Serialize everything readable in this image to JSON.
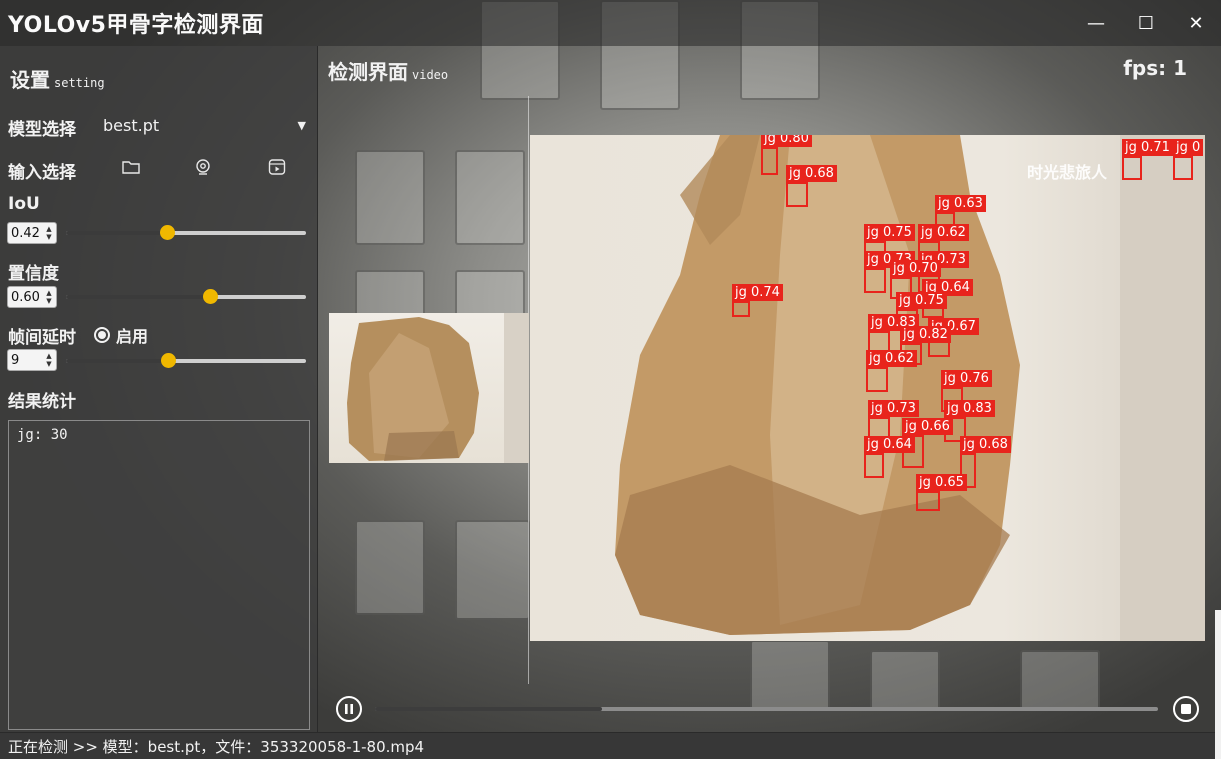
{
  "window": {
    "title": "YOLOv5甲骨字检测界面",
    "controls": {
      "minimize": "—",
      "maximize": "☐",
      "close": "✕"
    }
  },
  "settings": {
    "title": "设置",
    "subtitle": "setting",
    "model_label": "模型选择",
    "model_value": "best.pt",
    "input_label": "输入选择",
    "iou_label": "IoU",
    "iou_value": "0.42",
    "iou_level": 0.42,
    "conf_label": "置信度",
    "conf_value": "0.60",
    "conf_level": 0.6,
    "delay_label": "帧间延时",
    "delay_enable_label": "启用",
    "delay_value": "9",
    "results_title": "结果统计",
    "results_text": "jg: 30"
  },
  "main": {
    "title": "检测界面",
    "subtitle": "video",
    "fps_text": "fps: 1",
    "watermark": "时光悲旅人",
    "progress": 0.29
  },
  "detections": [
    {
      "label": "jg 0.80"
    },
    {
      "label": "jg 0.68"
    },
    {
      "label": "jg 0.63"
    },
    {
      "label": "jg 0.75"
    },
    {
      "label": "jg 0.62"
    },
    {
      "label": "jg 0.73"
    },
    {
      "label": "jg 0.73"
    },
    {
      "label": "jg 0.70"
    },
    {
      "label": "jg 0.64"
    },
    {
      "label": "jg 0.74"
    },
    {
      "label": "jg 0.75"
    },
    {
      "label": "jg 0.83"
    },
    {
      "label": "jg 0.67"
    },
    {
      "label": "jg 0.82"
    },
    {
      "label": "jg 0.62"
    },
    {
      "label": "jg 0.76"
    },
    {
      "label": "jg 0.73"
    },
    {
      "label": "jg 0.83"
    },
    {
      "label": "jg 0.66"
    },
    {
      "label": "jg 0.64"
    },
    {
      "label": "jg 0.68"
    },
    {
      "label": "jg 0.65"
    },
    {
      "label": "jg 0.71"
    },
    {
      "label": "jg 0"
    }
  ],
  "status": {
    "text": "正在检测 >> 模型：best.pt，文件：353320058-1-80.mp4"
  },
  "colors": {
    "accent": "#f0b800",
    "box": "#e8241c"
  }
}
